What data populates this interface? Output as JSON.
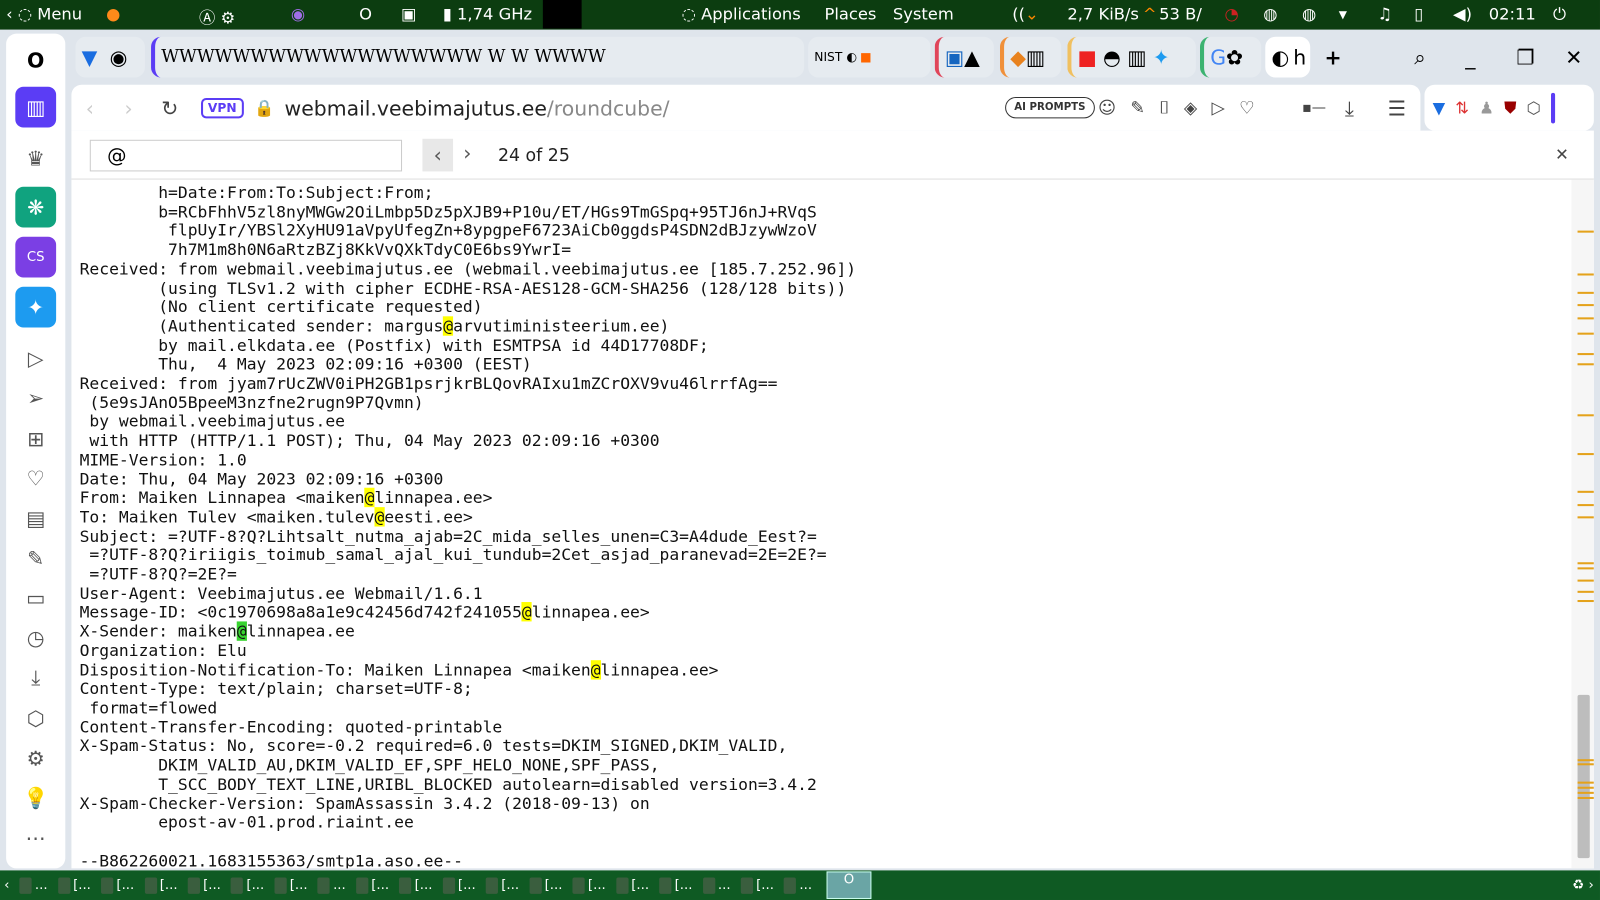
{
  "top_panel": {
    "menu": "Menu",
    "cpu": "1,74 GHz",
    "applications": "Applications",
    "places": "Places",
    "system": "System",
    "net_down": "2,7 KiB/s",
    "net_up": "53 B/",
    "clock": "02:11"
  },
  "tabs": {
    "active_tab_label": "h",
    "bookmark_text": "WWWWWWWWWWWWWWWWWW W W WWWW"
  },
  "address_bar": {
    "vpn": "VPN",
    "url_host": "webmail.veebimajutus.ee",
    "url_path": "/roundcube/",
    "ai_prompts": "AI PROMPTS"
  },
  "find_bar": {
    "query": "@",
    "match_count": "24 of 25"
  },
  "colors": {
    "highlight": "#ffff00",
    "current_match": "#38d430",
    "panel": "#0c3d10",
    "accent": "#5b3df5"
  },
  "current_match_line": 24,
  "raw_lines": [
    "        h=Date:From:To:Subject:From;",
    "        b=RCbFhhV5zl8nyMWGw2OiLmbp5Dz5pXJB9+P10u/ET/HGs9TmGSpq+95TJ6nJ+RVqS",
    "         flpUyIr/YBSl2XyHU91aVpyUfegZn+8ypgpeF6723AiCb0ggdsP4SDN2dBJzywWzoV",
    "         7h7M1m8h0N6aRtzBZj8KkVvQXkTdyC0E6bs9YwrI=",
    "Received: from webmail.veebimajutus.ee (webmail.veebimajutus.ee [185.7.252.96])",
    "        (using TLSv1.2 with cipher ECDHE-RSA-AES128-GCM-SHA256 (128/128 bits))",
    "        (No client certificate requested)",
    "        (Authenticated sender: margus@arvutiministeerium.ee)",
    "        by mail.elkdata.ee (Postfix) with ESMTPSA id 44D17708DF;",
    "        Thu,  4 May 2023 02:09:16 +0300 (EEST)",
    "Received: from jyam7rUcZWV0iPH2GB1psrjkrBLQovRAIxu1mZCrOXV9vu46lrrfAg==",
    " (5e9sJAnO5BpeeM3nzfne2rugn9P7Qvmn)",
    " by webmail.veebimajutus.ee",
    " with HTTP (HTTP/1.1 POST); Thu, 04 May 2023 02:09:16 +0300",
    "MIME-Version: 1.0",
    "Date: Thu, 04 May 2023 02:09:16 +0300",
    "From: Maiken Linnapea <maiken@linnapea.ee>",
    "To: Maiken Tulev <maiken.tulev@eesti.ee>",
    "Subject: =?UTF-8?Q?Lihtsalt_nutma_ajab=2C_mida_selles_unen=C3=A4dude_Eest?=",
    " =?UTF-8?Q?iriigis_toimub_samal_ajal_kui_tundub=2Cet_asjad_paranevad=2E=2E?=",
    " =?UTF-8?Q?=2E?=",
    "User-Agent: Veebimajutus.ee Webmail/1.6.1",
    "Message-ID: <0c1970698a8a1e9c42456d742f241055@linnapea.ee>",
    "X-Sender: maiken@linnapea.ee",
    "Organization: Elu",
    "Disposition-Notification-To: Maiken Linnapea <maiken@linnapea.ee>",
    "Content-Type: text/plain; charset=UTF-8;",
    " format=flowed",
    "Content-Transfer-Encoding: quoted-printable",
    "X-Spam-Status: No, score=-0.2 required=6.0 tests=DKIM_SIGNED,DKIM_VALID,",
    "        DKIM_VALID_AU,DKIM_VALID_EF,SPF_HELO_NONE,SPF_PASS,",
    "        T_SCC_BODY_TEXT_LINE,URIBL_BLOCKED autolearn=disabled version=3.4.2",
    "X-Spam-Checker-Version: SpamAssassin 3.4.2 (2018-09-13) on",
    "        epost-av-01.prod.riaint.ee",
    "",
    "--B862260021.1683155363/smtp1a.aso.ee--"
  ],
  "taskbar_items": [
    "...",
    "[...",
    "[...",
    "[...",
    "[...",
    "[...",
    "[...",
    "...",
    "[...",
    "[...",
    "[...",
    "[...",
    "[...",
    "[...",
    "[...",
    "[...",
    "...",
    "[...",
    "..."
  ]
}
